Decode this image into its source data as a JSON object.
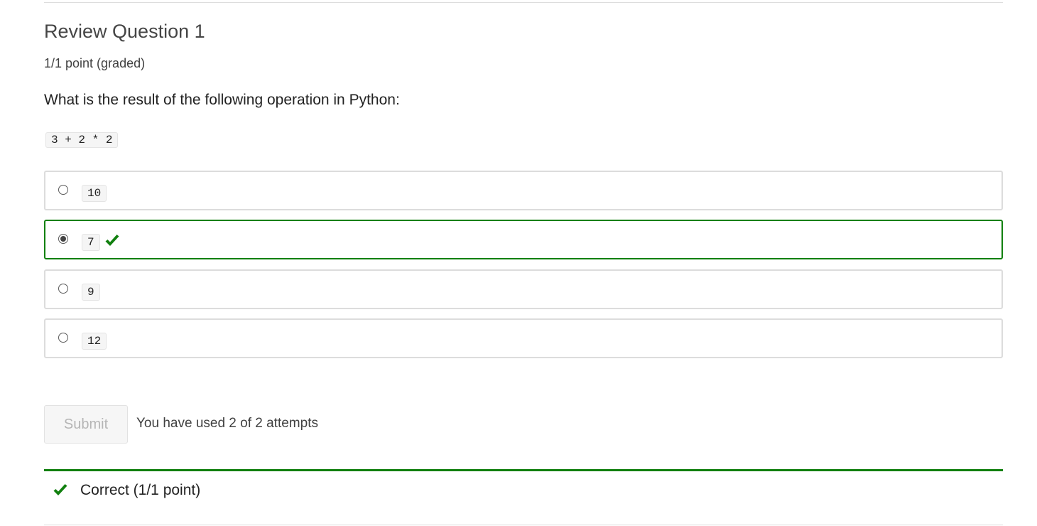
{
  "problem": {
    "title": "Review Question 1",
    "points": "1/1 point (graded)",
    "question": "What is the result of the following operation in Python:",
    "expression": "3 + 2 * 2"
  },
  "options": [
    {
      "label": "10",
      "selected": false
    },
    {
      "label": "7",
      "selected": true,
      "status": "correct"
    },
    {
      "label": "9",
      "selected": false
    },
    {
      "label": "12",
      "selected": false
    }
  ],
  "actions": {
    "submit_label": "Submit",
    "submit_disabled": true,
    "attempts_text": "You have used 2 of 2 attempts"
  },
  "result": {
    "status": "correct",
    "message": "Correct (1/1 point)",
    "icon": "checkmark-icon"
  },
  "colors": {
    "correct_green": "#11800f",
    "border_gray": "#dcdcdc"
  }
}
